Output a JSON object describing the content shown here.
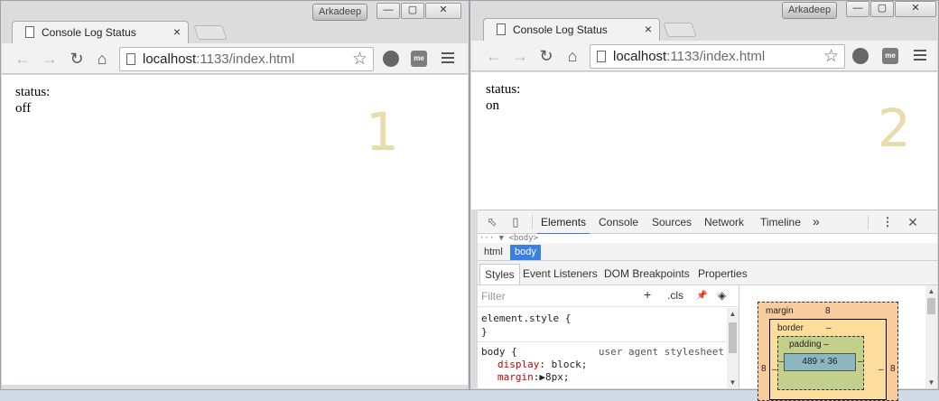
{
  "windows": [
    {
      "user": "Arkadeep",
      "controls": {
        "minimize": "—",
        "maximize": "▢",
        "close": "✕"
      },
      "tab": {
        "title": "Console Log Status",
        "close": "×"
      },
      "url": {
        "host": "localhost",
        "path": ":1133/index.html"
      },
      "page": {
        "label": "status:",
        "value": "off"
      },
      "overlay_number": "1"
    },
    {
      "user": "Arkadeep",
      "controls": {
        "minimize": "—",
        "maximize": "▢",
        "close": "✕"
      },
      "tab": {
        "title": "Console Log Status",
        "close": "×"
      },
      "url": {
        "host": "localhost",
        "path": ":1133/index.html"
      },
      "page": {
        "label": "status:",
        "value": "on"
      },
      "overlay_number": "2",
      "devtools": {
        "tabs": [
          "Elements",
          "Console",
          "Sources",
          "Network",
          "Timeline"
        ],
        "active_tab": "Elements",
        "more": "»",
        "dom_row": "··· ▼ <body>",
        "breadcrumbs": [
          "html",
          "body"
        ],
        "subtabs": [
          "Styles",
          "Event Listeners",
          "DOM Breakpoints",
          "Properties"
        ],
        "filter_placeholder": "Filter",
        "filter_tools": {
          "add": "+",
          "cls": ".cls",
          "pin": "📌",
          "toggle": "◈"
        },
        "styles": {
          "element_style_open": "element.style {",
          "element_style_close": "}",
          "body_selector": "body {",
          "ua_source": "user agent stylesheet",
          "display_prop": "display",
          "display_val": ": block;",
          "margin_prop": "margin",
          "margin_val": ":▶8px;"
        },
        "box_model": {
          "margin_label": "margin",
          "margin_top": "8",
          "margin_left": "8",
          "margin_right": "8",
          "border_label": "border",
          "border_top": "–",
          "border_left": "–",
          "border_right": "–",
          "padding_label": "padding –",
          "padding_left": "–",
          "padding_right": "–",
          "content": "489 × 36"
        }
      }
    }
  ],
  "colors": {
    "overlay_number": "#e8dcaa",
    "devtools_accent": "#3879d9",
    "breadcrumb_active": "#3b80e0",
    "css_property": "#c80000"
  }
}
